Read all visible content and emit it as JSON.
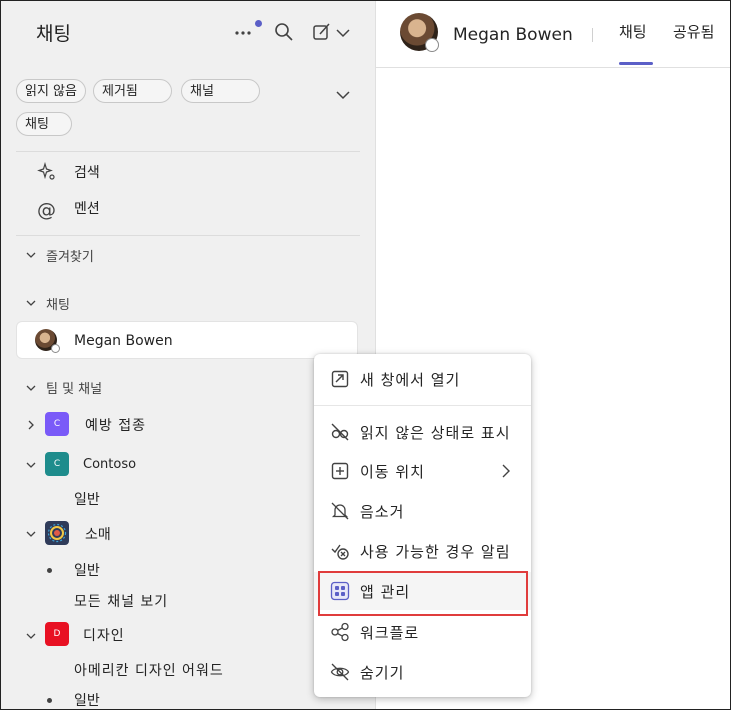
{
  "sidebar": {
    "title": "채팅",
    "filters": [
      "읽지 않음",
      "제거됨",
      "채널",
      "채팅"
    ],
    "quick_items": [
      {
        "label": "검색",
        "icon": "sparkle-search-icon"
      },
      {
        "label": "멘션",
        "icon": "at-icon"
      }
    ],
    "sections": {
      "favorites": "즐겨찾기",
      "chats": "채팅",
      "teams": "팀 및 채널"
    },
    "chat_contact": "Megan Bowen",
    "teams": [
      {
        "name": "예방 접종",
        "tile": "C",
        "color": "#7a5af8"
      },
      {
        "name": "Contoso",
        "tile": "C",
        "color": "#1e8c8c"
      },
      {
        "name": "소매",
        "tile": "",
        "color": "#2f3b59"
      },
      {
        "name": "디자인",
        "tile": "D",
        "color": "#e81123"
      }
    ],
    "channels": {
      "contoso_general": "일반",
      "retail_general": "일반",
      "retail_all": "모든 채널 보기",
      "design_award": "아메리칸 디자인 어워드",
      "design_general": "일반"
    }
  },
  "header": {
    "contact_name": "Megan Bowen",
    "tabs": [
      "채팅",
      "공유됨"
    ],
    "accent": "#5b5fc7"
  },
  "context_menu": {
    "items": [
      {
        "label": "새 창에서 열기",
        "icon": "open-new-window-icon"
      },
      {
        "label": "읽지 않은 상태로 표시",
        "icon": "mark-unread-icon"
      },
      {
        "label": "이동 위치",
        "icon": "move-to-icon"
      },
      {
        "label": "음소거",
        "icon": "mute-bell-icon"
      },
      {
        "label": "사용 가능한 경우 알림",
        "icon": "notify-available-icon"
      },
      {
        "label": "앱 관리",
        "icon": "manage-apps-icon"
      },
      {
        "label": "워크플로",
        "icon": "workflow-icon"
      },
      {
        "label": "숨기기",
        "icon": "hide-icon"
      }
    ],
    "highlight_color": "#e03c3c"
  }
}
